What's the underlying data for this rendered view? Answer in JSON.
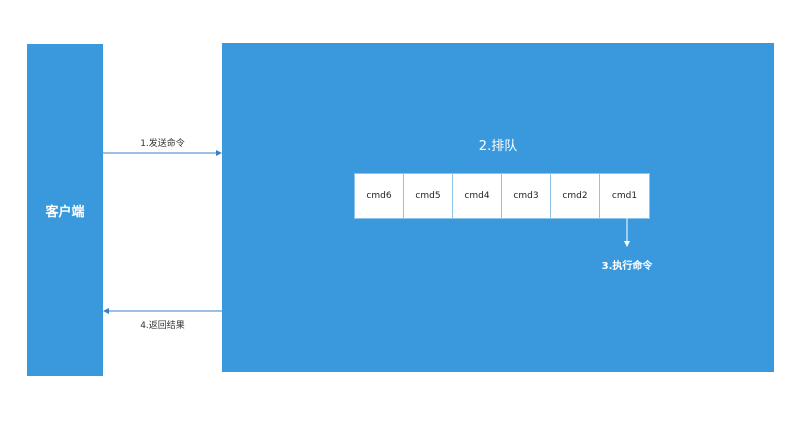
{
  "client": {
    "label": "客户端"
  },
  "server": {
    "title": "2.排队"
  },
  "queue": {
    "items": [
      "cmd6",
      "cmd5",
      "cmd4",
      "cmd3",
      "cmd2",
      "cmd1"
    ]
  },
  "arrows": {
    "send": "1.发送命令",
    "execute": "3.执行命令",
    "return": "4.返回结果"
  },
  "colors": {
    "box_fill": "#3a99dd",
    "queue_border": "#8ec3ea",
    "arrow": "#3a80c8"
  }
}
